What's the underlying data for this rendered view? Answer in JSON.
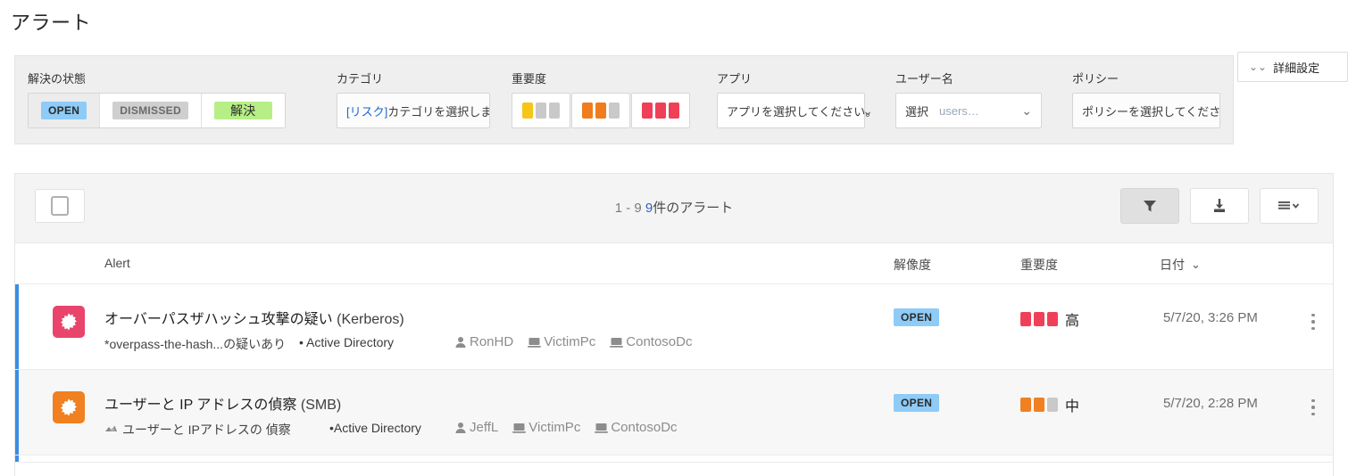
{
  "page": {
    "title": "アラート"
  },
  "filters": {
    "resolution": {
      "label": "解決の状態",
      "options": [
        {
          "text": "OPEN",
          "selected": true
        },
        {
          "text": "DISMISSED",
          "selected": false
        },
        {
          "text": "解決",
          "selected": false
        }
      ]
    },
    "category": {
      "label": "カテゴリ",
      "value_prefix": "[リスク]",
      "value_rest": " カテゴリを選択します。…"
    },
    "severity": {
      "label": "重要度",
      "options": [
        {
          "name": "low",
          "filled": 1,
          "color": "#f5c518"
        },
        {
          "name": "medium",
          "filled": 2,
          "color": "#f07c1e"
        },
        {
          "name": "high",
          "filled": 3,
          "color": "#ef4058"
        }
      ]
    },
    "app": {
      "label": "アプリ",
      "placeholder": "アプリを選択してください。",
      "icon": "chevron-down-icon"
    },
    "username": {
      "label": "ユーザー名",
      "value": "選択",
      "hint": "users…",
      "icon": "chevron-down-icon"
    },
    "policy": {
      "label": "ポリシー",
      "placeholder": "ポリシーを選択してください。"
    },
    "advanced": {
      "label": "詳細設定",
      "icon": "chevron-double-down-icon"
    }
  },
  "results": {
    "toolbar": {
      "select_all": "select-all-checkbox",
      "count_from": "1",
      "count_dash": "-",
      "count_to": "9",
      "count_total": "9",
      "count_suffix": "件のアラート",
      "filter_button": "filter-icon",
      "export_button": "download-icon",
      "list_button": "list-options-icon"
    },
    "columns": {
      "alert": "Alert",
      "resolution": "解像度",
      "severity": "重要度",
      "date": "日付"
    },
    "rows": [
      {
        "icon_color": "#e8446c",
        "title": "オーバーパスザハッシュ攻撃の疑い",
        "title_suffix": "(Kerberos)",
        "subtitle": "*overpass-the-hash...の疑いあり",
        "source": "• Active Directory",
        "category_icon": "",
        "entities": [
          {
            "icon": "user-icon",
            "name": "RonHD"
          },
          {
            "icon": "computer-icon",
            "name": "VictimPc"
          },
          {
            "icon": "computer-icon",
            "name": "ContosoDc"
          }
        ],
        "resolution": "OPEN",
        "severity_filled": 3,
        "severity_color": "#ef4058",
        "severity_label": "高",
        "date": "5/7/20, 3:26 PM",
        "alt": false
      },
      {
        "icon_color": "#f08020",
        "title": "ユーザーと IP アドレスの偵察",
        "title_suffix": "(SMB)",
        "subtitle": "ユーザーと IPアドレスの 偵察",
        "source": "•Active Directory",
        "category_icon": "recon-icon",
        "entities": [
          {
            "icon": "user-icon",
            "name": "JeffL"
          },
          {
            "icon": "computer-icon",
            "name": "VictimPc"
          },
          {
            "icon": "computer-icon",
            "name": "ContosoDc"
          }
        ],
        "resolution": "OPEN",
        "severity_filled": 2,
        "severity_color": "#f08020",
        "severity_label": "中",
        "date": "5/7/20, 2:28 PM",
        "alt": true
      }
    ]
  },
  "colors": {
    "accent_blue": "#3a8ee6",
    "open_badge_bg": "#8ecbf7",
    "resolved_badge_bg": "#b7ef86",
    "dismissed_badge_bg": "#cfcfcf"
  }
}
